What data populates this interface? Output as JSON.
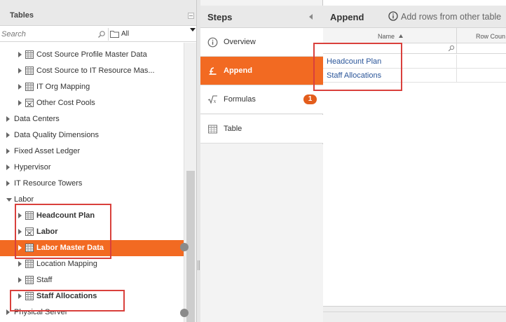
{
  "tables_panel": {
    "title": "Tables",
    "search_placeholder": "Search",
    "filter_value": "All"
  },
  "tree": [
    {
      "label": "Cost Source Profile Master Data",
      "icon": "table-icon",
      "bold": false,
      "selected": false
    },
    {
      "label": "Cost Source to IT Resource Mas...",
      "icon": "table-icon",
      "bold": false,
      "selected": false
    },
    {
      "label": "IT Org Mapping",
      "icon": "table-icon",
      "bold": false,
      "selected": false
    },
    {
      "label": "Other Cost Pools",
      "icon": "calc-table-icon",
      "bold": false,
      "selected": false
    },
    {
      "label": "Data Centers",
      "icon": "",
      "bold": false,
      "selected": false
    },
    {
      "label": "Data Quality Dimensions",
      "icon": "",
      "bold": false,
      "selected": false
    },
    {
      "label": "Fixed Asset Ledger",
      "icon": "",
      "bold": false,
      "selected": false
    },
    {
      "label": "Hypervisor",
      "icon": "",
      "bold": false,
      "selected": false
    },
    {
      "label": "IT Resource Towers",
      "icon": "",
      "bold": false,
      "selected": false
    },
    {
      "label": "Labor",
      "icon": "",
      "bold": false,
      "selected": false
    },
    {
      "label": "Headcount Plan",
      "icon": "table-icon",
      "bold": true,
      "selected": false
    },
    {
      "label": "Labor",
      "icon": "calc-table-icon",
      "bold": true,
      "selected": false
    },
    {
      "label": "Labor Master Data",
      "icon": "table-icon",
      "bold": true,
      "selected": true
    },
    {
      "label": "Location Mapping",
      "icon": "table-icon",
      "bold": false,
      "selected": false
    },
    {
      "label": "Staff",
      "icon": "table-icon",
      "bold": false,
      "selected": false
    },
    {
      "label": "Staff Allocations",
      "icon": "table-icon",
      "bold": true,
      "selected": false
    },
    {
      "label": "Physical Server",
      "icon": "",
      "bold": false,
      "selected": false
    }
  ],
  "steps_panel": {
    "title": "Steps",
    "steps": [
      {
        "label": "Overview",
        "icon": "info-icon",
        "active": false
      },
      {
        "label": "Append",
        "icon": "append-icon",
        "active": true
      },
      {
        "label": "Formulas",
        "icon": "formula-icon",
        "active": false,
        "badge": "1"
      },
      {
        "label": "Table",
        "icon": "table-icon",
        "active": false
      }
    ]
  },
  "append_panel": {
    "title": "Append",
    "hint": "Add rows from other table",
    "columns": {
      "name": "Name",
      "row_count": "Row Coun"
    },
    "rows": [
      "Headcount Plan",
      "Staff Allocations"
    ]
  },
  "colors": {
    "accent": "#f26a22",
    "badge": "#e35d1c",
    "highlight": "#d9403c",
    "link": "#2a5599"
  }
}
